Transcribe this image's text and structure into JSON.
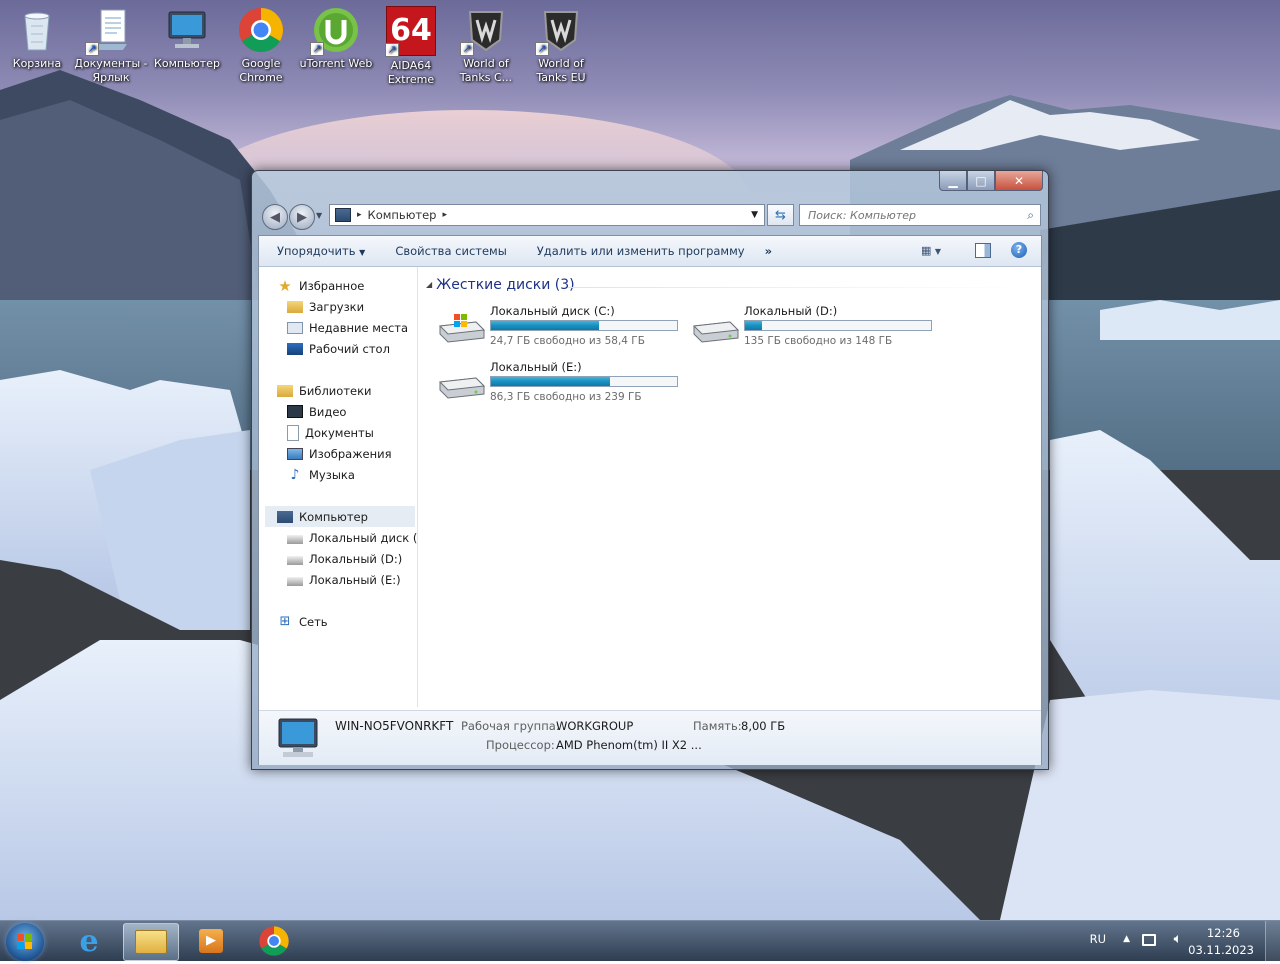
{
  "desktop": {
    "icons": [
      {
        "label": "Корзина",
        "icon": "recycle-bin-icon"
      },
      {
        "label": "Документы - Ярлык",
        "icon": "documents-shortcut-icon"
      },
      {
        "label": "Компьютер",
        "icon": "computer-icon"
      },
      {
        "label": "Google Chrome",
        "icon": "chrome-icon"
      },
      {
        "label": "uTorrent Web",
        "icon": "utorrent-icon"
      },
      {
        "label": "AIDA64 Extreme",
        "icon": "aida64-icon"
      },
      {
        "label": "World of Tanks C...",
        "icon": "wot-icon"
      },
      {
        "label": "World of Tanks EU",
        "icon": "wot-icon"
      }
    ],
    "aida_text": "64"
  },
  "window": {
    "caption": {
      "minimize": "▁",
      "maximize": "□",
      "close": "✕"
    },
    "address": {
      "crumb": "Компьютер",
      "sep": "▸"
    },
    "search": {
      "placeholder": "Поиск: Компьютер"
    },
    "toolbar": {
      "organize": "Упорядочить",
      "system_properties": "Свойства системы",
      "uninstall": "Удалить или изменить программу",
      "more": "»"
    },
    "nav": {
      "favorites": "Избранное",
      "downloads": "Загрузки",
      "recent": "Недавние места",
      "desktop": "Рабочий стол",
      "libraries": "Библиотеки",
      "video": "Видео",
      "documents": "Документы",
      "pictures": "Изображения",
      "music": "Музыка",
      "computer": "Компьютер",
      "drive_c": "Локальный диск (C:)",
      "drive_d": "Локальный (D:)",
      "drive_e": "Локальный  (E:)",
      "network": "Сеть"
    },
    "group_header": "Жесткие диски (3)",
    "drives": [
      {
        "name": "Локальный диск (C:)",
        "free_text": "24,7 ГБ свободно из 58,4 ГБ",
        "used_fraction": 0.58
      },
      {
        "name": "Локальный (D:)",
        "free_text": "135 ГБ свободно из 148 ГБ",
        "used_fraction": 0.09
      },
      {
        "name": "Локальный  (E:)",
        "free_text": "86,3 ГБ свободно из 239 ГБ",
        "used_fraction": 0.64
      }
    ],
    "details": {
      "computer_name": "WIN-NO5FVONRKFT",
      "workgroup_label": "Рабочая группа:",
      "workgroup_value": "WORKGROUP",
      "memory_label": "Память:",
      "memory_value": "8,00 ГБ",
      "cpu_label": "Процессор:",
      "cpu_value": "AMD Phenom(tm) II X2 ..."
    }
  },
  "taskbar": {
    "lang": "RU",
    "time": "12:26",
    "date": "03.11.2023",
    "tray_arrow": "▲"
  }
}
